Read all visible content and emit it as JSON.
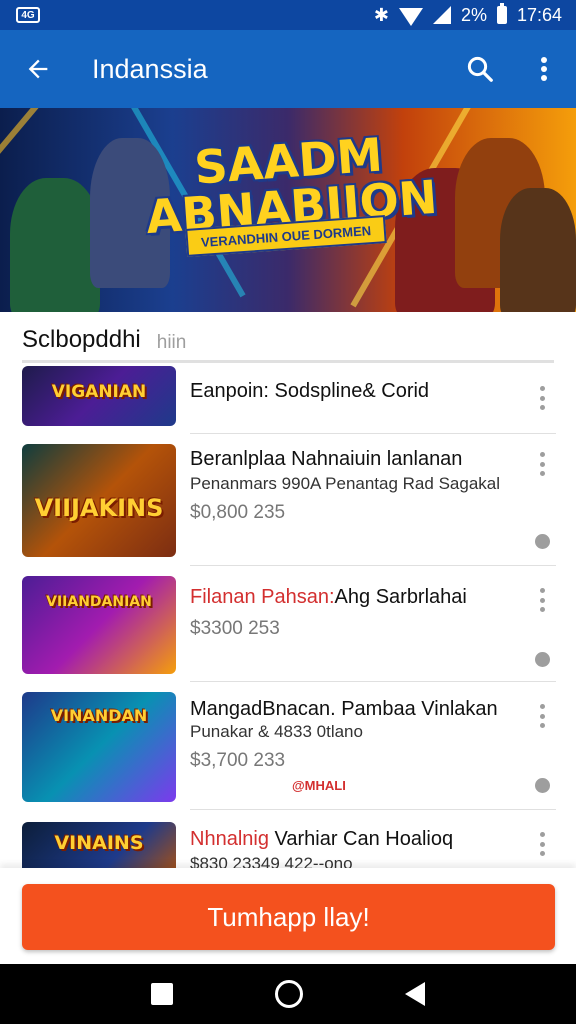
{
  "status_bar": {
    "sim_label": "4G",
    "battery": "2%",
    "time": "17:64"
  },
  "app_bar": {
    "title": "Indanssia"
  },
  "banner": {
    "title_line1": "SAADM",
    "title_line2": "ABNABIION",
    "ribbon": "VERANDHIN OUE DORMEN"
  },
  "section": {
    "title": "Sclbopddhi",
    "hint": "hiin"
  },
  "items": [
    {
      "thumb_text": "VIGANIAN",
      "title": "Eanpoin: Sodspline& Corid",
      "subtitle": "",
      "price": ""
    },
    {
      "thumb_text": "VIIJAKINS",
      "title": "Beranlplaa Nahnaiuin lanlanan",
      "subtitle": "Penanmars 990A Penantag Rad Sagakal",
      "price": "$0,800 235"
    },
    {
      "thumb_text": "VIIANDANIAN",
      "title_red": "Filanan Pahsan:",
      "title": "Ahg Sarbrlahai",
      "subtitle": "",
      "price": "$3300 253"
    },
    {
      "thumb_text": "VINANDAN",
      "title": "MangadBnacan. Pambaa Vinlakan",
      "subtitle": "Punakar & 4833 0tlano",
      "price": "$3,700 233",
      "badge": "@MHALI"
    },
    {
      "thumb_text": "VINAINS",
      "title_red": "Nhnalnig",
      "title": " Varhiar Can Hoalioq",
      "subtitle": "$830 23349 422--ono",
      "price": ""
    }
  ],
  "cta": {
    "label": "Tumhapp llay!"
  },
  "colors": {
    "app_bar": "#1565c0",
    "status_bar": "#0d47a1",
    "cta": "#f4511e",
    "accent_red": "#d32f2f"
  }
}
